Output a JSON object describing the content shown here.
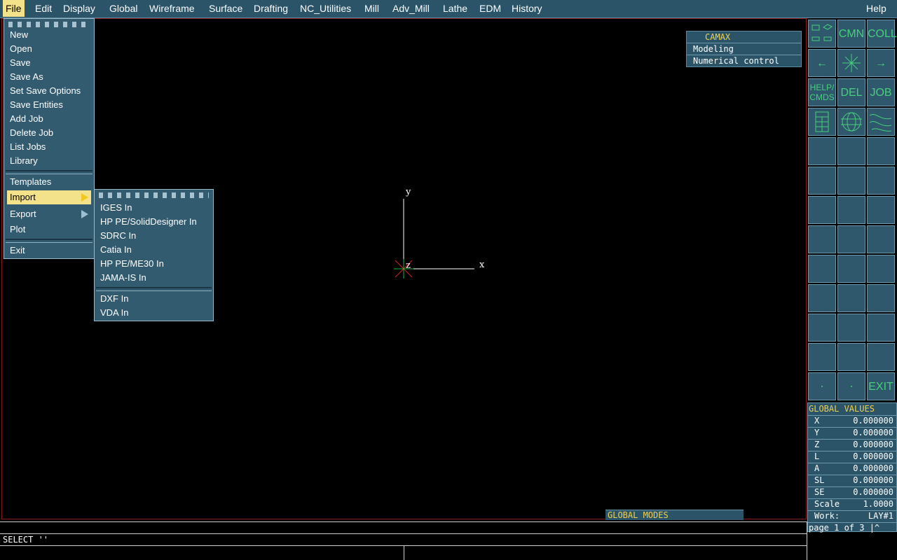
{
  "menubar": {
    "items": [
      "File",
      "Edit",
      "Display",
      "Global",
      "Wireframe",
      "Surface",
      "Drafting",
      "NC_Utilities",
      "Mill",
      "Adv_Mill",
      "Lathe",
      "EDM",
      "History"
    ],
    "help": "Help"
  },
  "file_menu": {
    "items": [
      "New",
      "Open",
      "Save",
      "Save As",
      "Set Save Options",
      "Save Entities",
      "Add Job",
      "Delete Job",
      "List Jobs",
      "Library"
    ],
    "group2": [
      "Templates",
      "Import",
      "Export",
      "Plot"
    ],
    "exit": "Exit"
  },
  "import_menu": {
    "items": [
      "IGES In",
      "HP PE/SolidDesigner In",
      "SDRC In",
      "Catia In",
      "HP PE/ME30 In",
      "JAMA-IS In"
    ],
    "group2": [
      "DXF In",
      "VDA In"
    ]
  },
  "axes": {
    "x": "x",
    "y": "y",
    "z": "z"
  },
  "camax": {
    "title": "CAMAX",
    "items": [
      "Modeling",
      "Numerical control"
    ]
  },
  "palette": {
    "cmn": "CMN",
    "coll": "COLL",
    "help1": "HELP/",
    "help2": "CMDS",
    "del": "DEL",
    "job": "JOB",
    "exit": "EXIT",
    "left_arrow": "←",
    "right_arrow": "→"
  },
  "global_values": {
    "title": "GLOBAL VALUES",
    "rows": [
      {
        "label": "X",
        "value": "0.000000"
      },
      {
        "label": "Y",
        "value": "0.000000"
      },
      {
        "label": "Z",
        "value": "0.000000"
      },
      {
        "label": "L",
        "value": "0.000000"
      },
      {
        "label": "A",
        "value": "0.000000"
      },
      {
        "label": "SL",
        "value": "0.000000"
      },
      {
        "label": "SE",
        "value": "0.000000"
      }
    ],
    "scale_label": "Scale",
    "scale_value": "1.0000",
    "work_label": "Work:",
    "work_value": "LAY#1",
    "page": "page 1 of 3 |^"
  },
  "global_modes": "GLOBAL MODES",
  "command": "SELECT ''",
  "colors": {
    "menubar": "#2b5468",
    "highlight": "#f4e28a",
    "palette_text": "#45d07c",
    "title_yellow": "#f0d050"
  }
}
